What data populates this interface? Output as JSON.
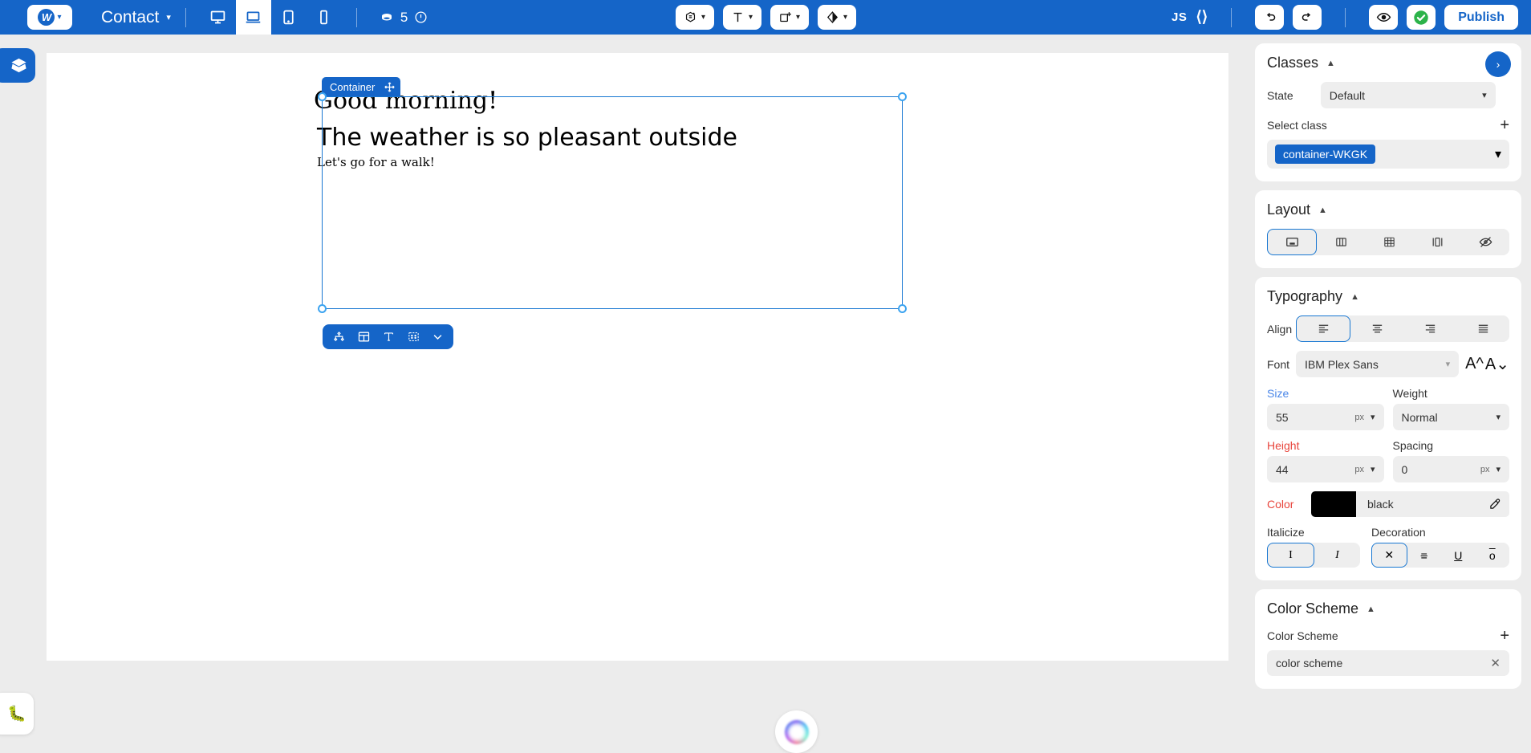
{
  "topbar": {
    "logo_mark": "W",
    "logo_caret": "chevron-down-icon",
    "project_name": "Contact",
    "project_caret": "⌄",
    "devices": [
      {
        "name": "desktop",
        "label": "Desktop",
        "active": false
      },
      {
        "name": "laptop",
        "label": "Laptop",
        "active": true
      },
      {
        "name": "tablet",
        "label": "Tablet",
        "active": false
      },
      {
        "name": "mobile",
        "label": "Mobile",
        "active": false
      }
    ],
    "cms_count": "5",
    "cms_icon": "database-icon",
    "info_icon": "alert-circle-icon",
    "center_tools": [
      {
        "name": "settings-paint",
        "icon": "paint-palette-icon"
      },
      {
        "name": "text-tool",
        "icon": "text-T-icon"
      },
      {
        "name": "add-element",
        "icon": "add-box-icon"
      },
      {
        "name": "theme-tool",
        "icon": "contrast-diamond-icon"
      }
    ],
    "js_label": "JS",
    "code_icon": "code-brackets-icon",
    "undo_icon": "undo-arrow-icon",
    "redo_icon": "redo-arrow-icon",
    "preview_icon": "eye-icon",
    "status_icon": "green-check-icon",
    "publish_label": "Publish"
  },
  "left_rail": {
    "layers_icon": "layers-icon",
    "bug_icon": "bug-icon"
  },
  "canvas": {
    "selection": {
      "tag_label": "Container",
      "move_icon": "move-arrows-icon",
      "toolbar_icons": [
        "node-tree-icon",
        "layout-columns-icon",
        "text-T-icon",
        "padding-box-icon",
        "chevron-down-icon"
      ]
    },
    "content": {
      "heading": "Good morning!",
      "subheading": "The weather is so pleasant outside",
      "paragraph": "Let's go for a walk!"
    },
    "ai_orb": "ai-assistant-orb"
  },
  "right_panel": {
    "classes": {
      "title": "Classes",
      "next_icon": "›",
      "state_label": "State",
      "state_value": "Default",
      "select_class_label": "Select class",
      "add_icon": "+",
      "class_chip": "container-WKGK"
    },
    "layout": {
      "title": "Layout",
      "options": [
        {
          "name": "block",
          "icon": "block-layout-icon",
          "active": true
        },
        {
          "name": "flex",
          "icon": "flex-layout-icon",
          "active": false
        },
        {
          "name": "grid",
          "icon": "grid-layout-icon",
          "active": false
        },
        {
          "name": "columns",
          "icon": "columns-layout-icon",
          "active": false
        },
        {
          "name": "none",
          "icon": "hidden-eye-icon",
          "active": false
        }
      ]
    },
    "typography": {
      "title": "Typography",
      "align_label": "Align",
      "align_options": [
        {
          "name": "align-left",
          "active": true
        },
        {
          "name": "align-center",
          "active": false
        },
        {
          "name": "align-right",
          "active": false
        },
        {
          "name": "align-justify",
          "active": false
        }
      ],
      "font_label": "Font",
      "font_value": "IBM Plex Sans",
      "font_increase_icon": "A-increase-icon",
      "font_decrease_icon": "A-decrease-icon",
      "size_label": "Size",
      "size_value": "55",
      "size_unit": "px",
      "weight_label": "Weight",
      "weight_value": "Normal",
      "height_label": "Height",
      "height_value": "44",
      "height_unit": "px",
      "spacing_label": "Spacing",
      "spacing_value": "0",
      "spacing_unit": "px",
      "color_label": "Color",
      "color_value": "black",
      "color_hex": "#000000",
      "eyedropper_icon": "eyedropper-icon",
      "italicize_label": "Italicize",
      "italic_options": [
        {
          "name": "normal",
          "glyph": "I",
          "active": true
        },
        {
          "name": "italic",
          "glyph": "I",
          "active": false
        }
      ],
      "decoration_label": "Decoration",
      "decoration_options": [
        {
          "name": "none",
          "glyph": "✕",
          "active": true
        },
        {
          "name": "line-through",
          "glyph": "≡",
          "active": false
        },
        {
          "name": "underline",
          "glyph": "U",
          "active": false
        },
        {
          "name": "overline",
          "glyph": "o",
          "active": false
        }
      ]
    },
    "color_scheme": {
      "title": "Color Scheme",
      "field_label": "Color Scheme",
      "add_icon": "+",
      "value": "color scheme",
      "clear_icon": "✕"
    }
  },
  "colors": {
    "brand_blue": "#1565c8",
    "selection_blue": "#1877d2",
    "panel_bg": "#ececec",
    "label_blue": "#4a86e8",
    "label_red": "#e8453c",
    "text_black": "#000000"
  }
}
